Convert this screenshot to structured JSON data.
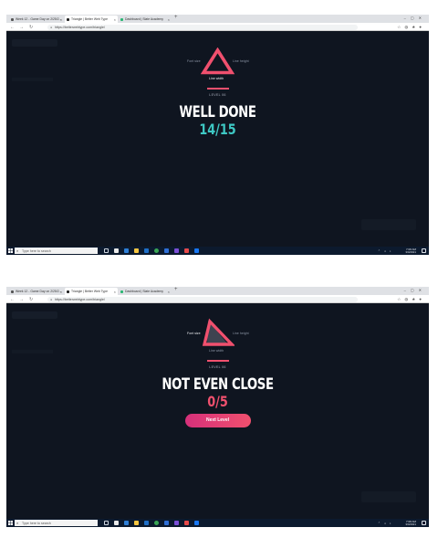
{
  "screenshots": [
    {
      "browser": {
        "tabs": [
          {
            "label": "Week 12 - Game Day on 2/25/2…"
          },
          {
            "label": "Triangle | Better Web Type"
          },
          {
            "label": "Dashboard | Slate Academy"
          }
        ],
        "url": "https://betterwebtype.com/triangle/"
      },
      "game": {
        "left_label": "Font size",
        "right_label": "Line height",
        "bottom_label": "Line width",
        "highlighted": "bottom",
        "level_label": "LEVEL 06",
        "verdict": "WELL DONE",
        "score": "14/15",
        "score_color": "#3ec8c4"
      },
      "taskbar": {
        "search_placeholder": "Type here to search",
        "time": "7:08 AM",
        "date": "3/4/2021"
      }
    },
    {
      "browser": {
        "tabs": [
          {
            "label": "Week 12 - Game Day on 2/25/2…"
          },
          {
            "label": "Triangle | Better Web Type"
          },
          {
            "label": "Dashboard | Slate Academy"
          }
        ],
        "url": "https://betterwebtype.com/triangle/"
      },
      "game": {
        "left_label": "Font size",
        "right_label": "Line height",
        "bottom_label": "Line width",
        "highlighted": "left",
        "level_label": "LEVEL 06",
        "verdict": "NOT EVEN CLOSE",
        "score": "0/5",
        "score_color": "#f0506e",
        "next_button": "Next Level"
      },
      "taskbar": {
        "search_placeholder": "Type here to search",
        "time": "7:08 AM",
        "date": "3/4/2021"
      }
    }
  ],
  "colors": {
    "background": "#0f1520",
    "accent": "#f0506e",
    "success": "#3ec8c4"
  },
  "icons": [
    "lock-icon",
    "back-icon",
    "forward-icon",
    "reload-icon",
    "windows-start-icon",
    "search-icon",
    "notification-icon"
  ]
}
